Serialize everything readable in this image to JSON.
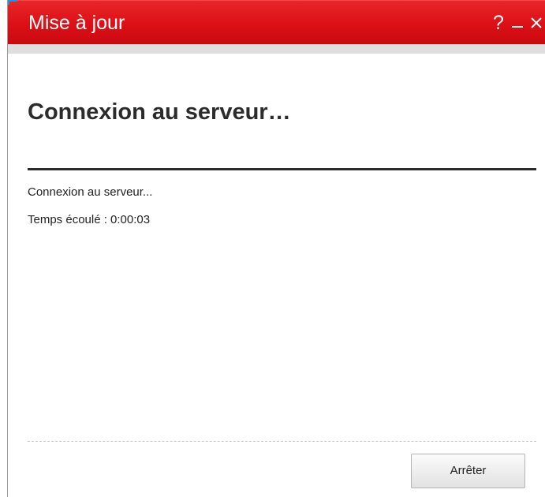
{
  "window": {
    "title": "Mise à jour",
    "help_label": "?",
    "accent_color": "#dc1016"
  },
  "title_controls": {
    "help_icon": "question-mark-icon",
    "minimize_icon": "minimize-icon",
    "close_icon": "close-icon"
  },
  "main": {
    "heading": "Connexion au serveur…",
    "status_text": "Connexion au serveur...",
    "elapsed_text": "Temps écoulé : 0:00:03"
  },
  "footer": {
    "stop_label": "Arrêter"
  }
}
